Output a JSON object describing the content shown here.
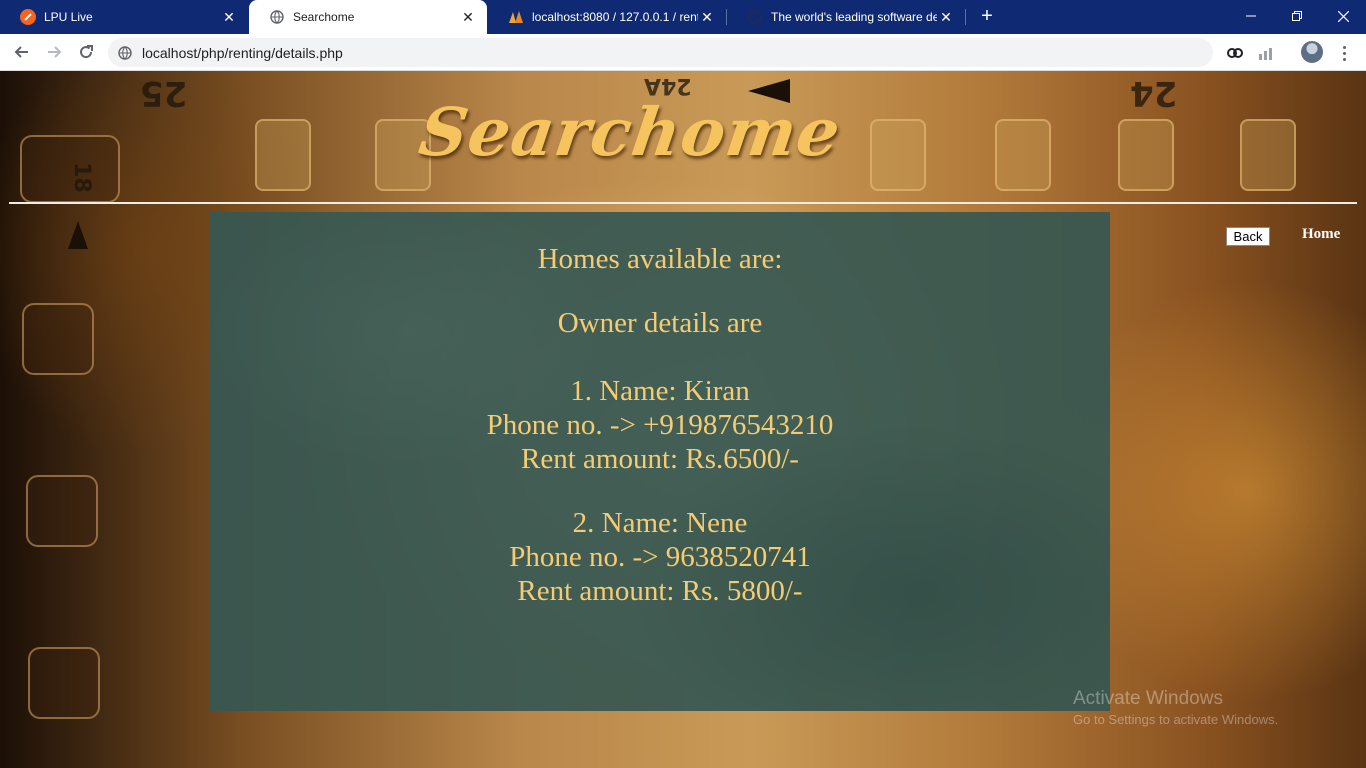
{
  "browser": {
    "tabs": [
      {
        "title": "LPU Live",
        "icon": "lpu-icon",
        "active": false
      },
      {
        "title": "Searchome",
        "icon": "globe-icon",
        "active": true
      },
      {
        "title": "localhost:8080 / 127.0.0.1 / rentir",
        "icon": "phpmyadmin-icon",
        "active": false
      },
      {
        "title": "The world's leading software dev",
        "icon": "github-icon",
        "active": false
      }
    ],
    "new_tab": "+",
    "address": "localhost/php/renting/details.php"
  },
  "site": {
    "logo": "Searchome",
    "nav": {
      "back_label": "Back",
      "home_label": "Home"
    },
    "content": {
      "heading": "Homes available are:",
      "subheading": "Owner details are",
      "owners": [
        {
          "name_line": "1. Name: Kiran",
          "phone_line": "Phone no. -> +919876543210",
          "rent_line": "Rent amount: Rs.6500/-"
        },
        {
          "name_line": "2. Name: Nene",
          "phone_line": "Phone no. -> 9638520741",
          "rent_line": "Rent amount: Rs. 5800/-"
        }
      ]
    }
  },
  "background_numbers": [
    "25",
    "24A",
    "24",
    "18"
  ],
  "watermark": {
    "line1": "Activate Windows",
    "line2": "Go to Settings to activate Windows."
  },
  "colors": {
    "tab_strip": "#0f2a72",
    "panel": "#375752",
    "panel_text": "#f5cc73",
    "logo": "#f6c45e"
  }
}
